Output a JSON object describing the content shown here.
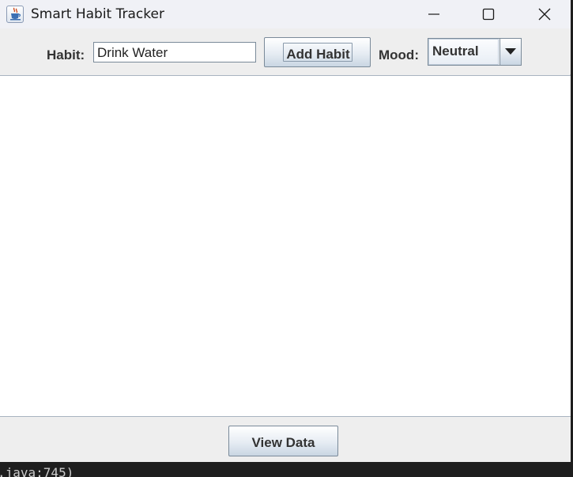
{
  "window": {
    "title": "Smart Habit Tracker",
    "icon": "java-cup-icon"
  },
  "titlebar_controls": {
    "minimize_icon": "minimize-icon",
    "maximize_icon": "maximize-icon",
    "close_icon": "close-icon"
  },
  "toolbar": {
    "habit_label": "Habit:",
    "habit_value": "Drink Water",
    "add_button_label": "Add Habit",
    "mood_label": "Mood:",
    "mood_selected": "Neutral",
    "mood_arrow_icon": "chevron-down-icon"
  },
  "main": {
    "habit_list": []
  },
  "footer": {
    "view_button_label": "View Data"
  },
  "background_console": {
    "text": ".java:745)"
  },
  "colors": {
    "titlebar_bg": "#f0f1f6",
    "panel_bg": "#eeeeee",
    "content_bg": "#ffffff",
    "button_border": "#7a8a99",
    "console_bg": "#1e1e1e"
  }
}
